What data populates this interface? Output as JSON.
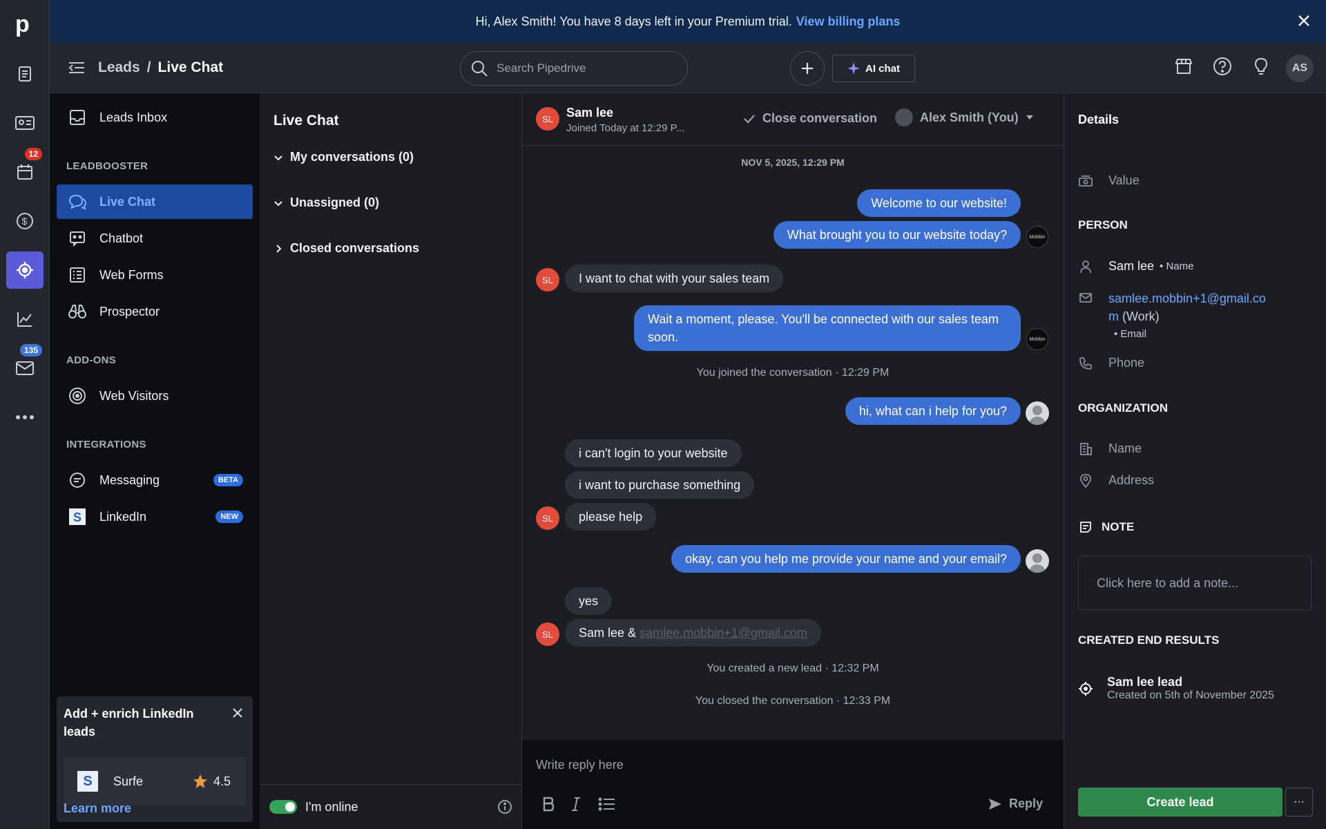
{
  "banner": {
    "text": "Hi, Alex Smith! You have 8 days left in your Premium trial.",
    "link": "View billing plans"
  },
  "rail": {
    "badge_activities": "12",
    "badge_mail": "135"
  },
  "topbar": {
    "breadcrumb_parent": "Leads",
    "breadcrumb_sep": "/",
    "breadcrumb_current": "Live Chat",
    "search_placeholder": "Search Pipedrive",
    "ai_chat": "AI chat",
    "user_initials": "AS"
  },
  "sidebar": {
    "inbox": "Leads Inbox",
    "section_leadbooster": "LEADBOOSTER",
    "live_chat": "Live Chat",
    "chatbot": "Chatbot",
    "web_forms": "Web Forms",
    "prospector": "Prospector",
    "section_addons": "ADD-ONS",
    "web_visitors": "Web Visitors",
    "section_integrations": "INTEGRATIONS",
    "messaging": "Messaging",
    "messaging_tag": "BETA",
    "linkedin": "LinkedIn",
    "linkedin_tag": "NEW"
  },
  "promo": {
    "title": "Add + enrich LinkedIn leads",
    "app_name": "Surfe",
    "rating": "4.5",
    "link": "Learn more"
  },
  "conversations": {
    "title": "Live Chat",
    "mine": "My conversations (0)",
    "unassigned": "Unassigned (0)",
    "closed": "Closed conversations",
    "online_label": "I'm online"
  },
  "chat": {
    "visitor_initials": "SL",
    "visitor_name": "Sam lee",
    "visitor_joined": "Joined Today at 12:29 P...",
    "close_label": "Close conversation",
    "owner": "Alex Smith (You)",
    "date": "NOV 5, 2025, 12:29 PM",
    "m1": "Welcome to our website!",
    "m2": "What brought you to our website today?",
    "m3": "I want to chat with your sales team",
    "m4": "Wait a moment, please. You'll be connected with our sales team soon.",
    "sys1": "You joined the conversation · 12:29 PM",
    "m5": "hi, what can i help for you?",
    "m6": "i can't login to your website",
    "m7": "i want to purchase something",
    "m8": "please help",
    "m9": "okay, can you help me provide your name and your email?",
    "m10": "yes",
    "m11_prefix": "Sam lee &",
    "m11_email": "samlee.mobbin+1@gmail.com",
    "sys2": "You created a new lead · 12:32 PM",
    "sys3": "You closed the conversation · 12:33 PM",
    "bot_label": "Mobbin",
    "composer_placeholder": "Write reply here",
    "reply": "Reply"
  },
  "details": {
    "title": "Details",
    "value": "Value",
    "person_head": "PERSON",
    "person_name": "Sam lee",
    "person_name_type": "Name",
    "email_line1": "samlee.mobbin+1@gmail.co",
    "email_line2": "m",
    "email_kind": "(Work)",
    "email_type": "Email",
    "phone": "Phone",
    "org_head": "ORGANIZATION",
    "org_name": "Name",
    "org_address": "Address",
    "note_head": "NOTE",
    "note_placeholder": "Click here to add a note...",
    "results_head": "CREATED END RESULTS",
    "lead_title": "Sam lee lead",
    "lead_sub": "Created on 5th of November 2025",
    "create_button": "Create lead",
    "more_button": "···"
  }
}
